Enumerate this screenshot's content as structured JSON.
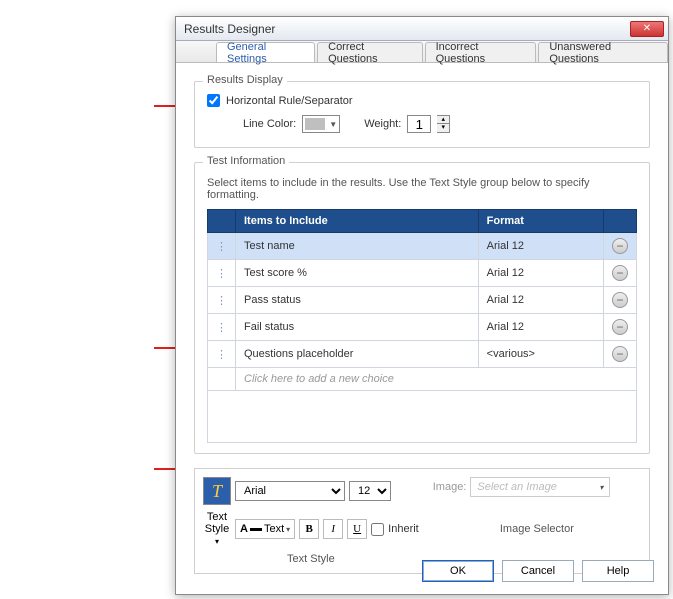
{
  "window": {
    "title": "Results Designer"
  },
  "tabs": {
    "t0": "General Settings",
    "t1": "Correct Questions",
    "t2": "Incorrect Questions",
    "t3": "Unanswered Questions"
  },
  "resultsDisplay": {
    "legend": "Results Display",
    "hrLabel": "Horizontal Rule/Separator",
    "lineColorLabel": "Line Color:",
    "weightLabel": "Weight:",
    "weightValue": "1"
  },
  "testInfo": {
    "legend": "Test Information",
    "hint": "Select items to include in the results. Use the Text Style group below to specify formatting.",
    "headers": {
      "items": "Items to Include",
      "format": "Format"
    },
    "rows": [
      {
        "item": "Test name",
        "format": "Arial 12"
      },
      {
        "item": "Test score %",
        "format": "Arial 12"
      },
      {
        "item": "Pass status",
        "format": "Arial 12"
      },
      {
        "item": "Fail status",
        "format": "Arial 12"
      },
      {
        "item": "Questions placeholder",
        "format": "<various>"
      }
    ],
    "addRow": "Click here to add a new choice"
  },
  "textStyle": {
    "textStyleLabel": "Text Style",
    "font": "Arial",
    "size": "12",
    "textBtn": "Text",
    "inherit": "Inherit",
    "caption": "Text Style",
    "bold": "B",
    "italic": "I",
    "underline": "U",
    "styleDropdown": "Text Style"
  },
  "imageSelector": {
    "label": "Image:",
    "placeholder": "Select an Image",
    "caption": "Image Selector"
  },
  "buttons": {
    "ok": "OK",
    "cancel": "Cancel",
    "help": "Help"
  }
}
